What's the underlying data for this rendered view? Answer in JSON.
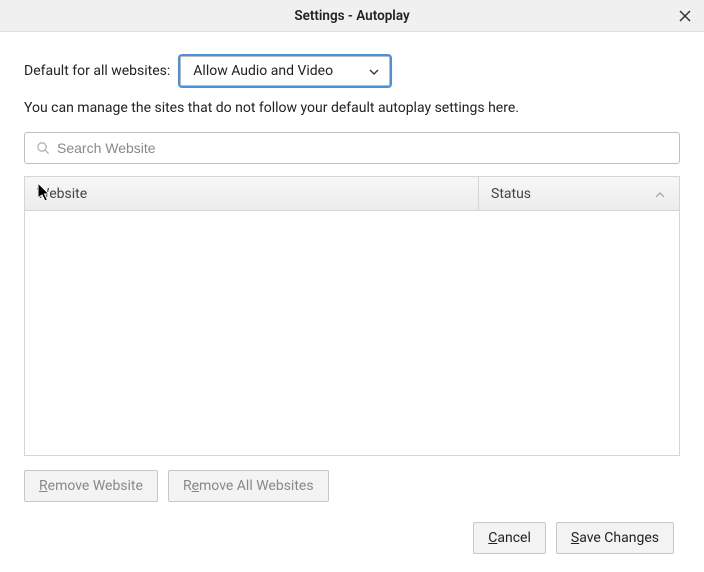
{
  "titlebar": {
    "title": "Settings - Autoplay"
  },
  "default": {
    "label": "Default for all websites:",
    "selected": "Allow Audio and Video"
  },
  "help_text": "You can manage the sites that do not follow your default autoplay settings here.",
  "search": {
    "placeholder": "Search Website"
  },
  "table": {
    "col_website": "Website",
    "col_status": "Status",
    "rows": []
  },
  "buttons": {
    "remove_website": {
      "pre": "",
      "accel": "R",
      "post": "emove Website"
    },
    "remove_all": {
      "pre": "R",
      "accel": "e",
      "post": "move All Websites"
    },
    "cancel": {
      "pre": "",
      "accel": "C",
      "post": "ancel"
    },
    "save": {
      "pre": "",
      "accel": "S",
      "post": "ave Changes"
    }
  }
}
